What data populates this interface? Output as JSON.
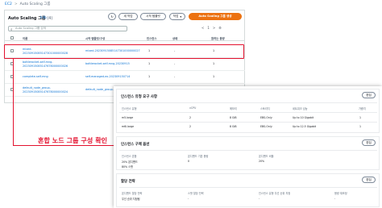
{
  "breadcrumb": {
    "root": "EC2",
    "separator": ">",
    "current": "Auto Scaling 그룹"
  },
  "list": {
    "title": "Auto Scaling 그룹",
    "count": "(4)",
    "info": "Info",
    "buttons": {
      "refresh": "↻",
      "create_action": "새 작업",
      "actions": "작업",
      "launch_template": "시작 템플릿",
      "create_group": "Auto Scaling 그룹 생성"
    },
    "search_placeholder": "Auto Scaling 그룹 검색",
    "pager": {
      "prev": "<",
      "page": "1",
      "next": ">",
      "settings": "⚙"
    },
    "columns": [
      "이름",
      "시작 템플릿/구성",
      "인스턴스",
      "상태",
      "원하는 용량"
    ],
    "rows": [
      {
        "name_line1": "mixed-",
        "name_line2": "20230915085147301000000028",
        "template": "mixed-20230915085147301000000027",
        "instances": "1",
        "status": "-",
        "desired": "1"
      },
      {
        "name_line1": "bottlerocket-self-mng-",
        "name_line2": "20230915085147678000000026",
        "template": "bottlerocket-self-mng-20230915",
        "instances": "1",
        "status": "-",
        "desired": "1"
      },
      {
        "name_line1": "complete-self-mng",
        "name_line2": "",
        "template": "self-managed-ex-202309150714",
        "instances": "1",
        "status": "-",
        "desired": "1"
      },
      {
        "name_line1": "default_node_group-",
        "name_line2": "20230915085147678000000024",
        "template": "default_node_group-202309150714",
        "instances": "1",
        "status": "-",
        "desired": "1"
      }
    ]
  },
  "callout": {
    "text": "혼합 노드 그룹 구성 확인",
    "color": "#e3122f"
  },
  "detail": {
    "instance_req": {
      "title": "인스턴스 유형 요구 사항",
      "edit": "편집",
      "columns": [
        "인스턴스 유형",
        "vCPU",
        "메모리",
        "스토리지",
        "네트워크 성능",
        "가중치"
      ],
      "rows": [
        [
          "m5.large",
          "2",
          "8 GiB",
          "EBS-Only",
          "Up to 10 Gigabit",
          "1"
        ],
        [
          "m6i.large",
          "2",
          "8 GiB",
          "EBS-Only",
          "Up to 12.5 Gigabit",
          "1"
        ]
      ]
    },
    "purchase": {
      "title": "인스턴스 구매 옵션",
      "edit": "편집",
      "labels": [
        "인스턴스 혼합",
        "온디맨드 기본 용량",
        "온디맨드 비율"
      ],
      "values": [
        "20% 온디맨드",
        "0",
        "20%"
      ],
      "sub_values": [
        "80% 스팟",
        "",
        ""
      ]
    },
    "allocation": {
      "title": "할당 전략",
      "edit": "편집",
      "labels": [
        "온디맨드 할당 전략",
        "스팟 할당 전략",
        "인스턴스 유형 우선 순위 지정",
        "용량 재조정"
      ],
      "values": [
        "우선 순위 지정됨",
        "-",
        "-",
        "-"
      ]
    }
  }
}
